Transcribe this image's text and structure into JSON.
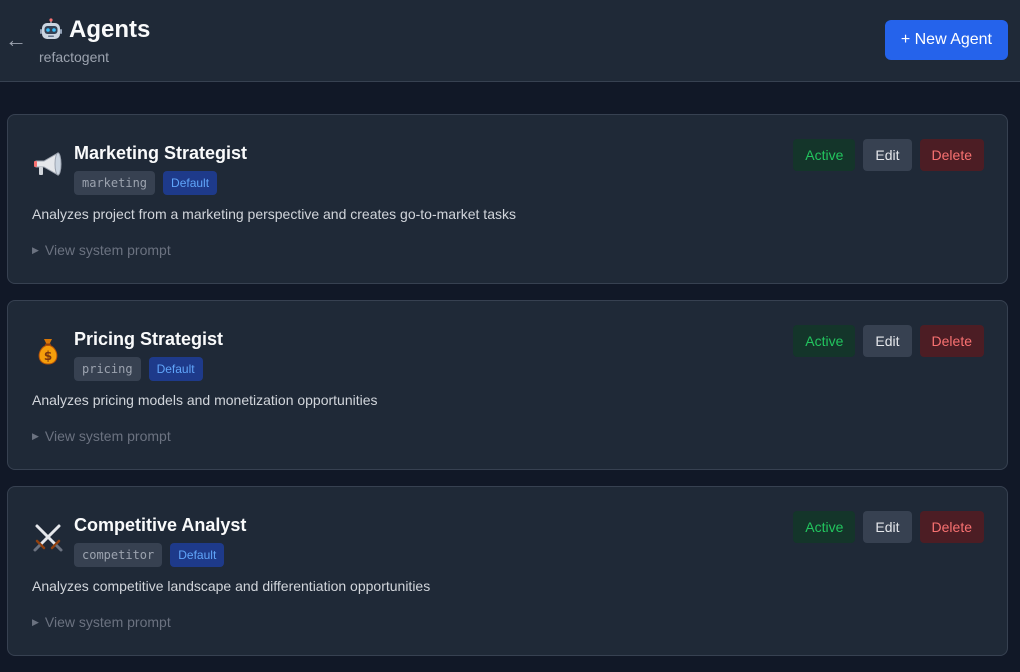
{
  "header": {
    "back_glyph": "←",
    "title": "Agents",
    "subtitle": "refactogent",
    "new_button": "+ New Agent"
  },
  "agents": [
    {
      "name": "Marketing Strategist",
      "icon": "megaphone-icon",
      "id_tag": "marketing",
      "default_badge": "Default",
      "description": "Analyzes project from a marketing perspective and creates go-to-market tasks",
      "prompt_toggle": "View system prompt",
      "status_label": "Active",
      "edit_label": "Edit",
      "delete_label": "Delete"
    },
    {
      "name": "Pricing Strategist",
      "icon": "money-bag-icon",
      "id_tag": "pricing",
      "default_badge": "Default",
      "description": "Analyzes pricing models and monetization opportunities",
      "prompt_toggle": "View system prompt",
      "status_label": "Active",
      "edit_label": "Edit",
      "delete_label": "Delete"
    },
    {
      "name": "Competitive Analyst",
      "icon": "crossed-swords-icon",
      "id_tag": "competitor",
      "default_badge": "Default",
      "description": "Analyzes competitive landscape and differentiation opportunities",
      "prompt_toggle": "View system prompt",
      "status_label": "Active",
      "edit_label": "Edit",
      "delete_label": "Delete"
    }
  ],
  "colors": {
    "background": "#111827",
    "surface": "#1f2937",
    "accent": "#2563eb",
    "active": "#22c55e",
    "danger": "#f87171",
    "default_badge": "#60a5fa"
  }
}
